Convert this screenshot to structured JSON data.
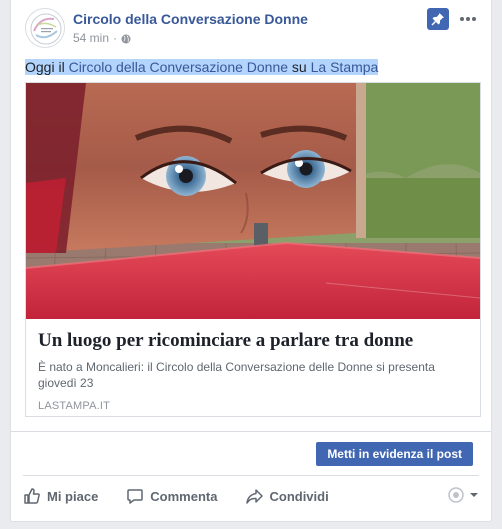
{
  "post": {
    "page_name": "Circolo della Conversazione Donne",
    "time": "54 min",
    "separator": "·",
    "text_prefix": "Oggi il ",
    "text_link1": "Circolo della Conversazione Donne",
    "text_middle": " su ",
    "text_link2": "La Stampa"
  },
  "share": {
    "title": "Un luogo per ricominciare a parlare tra donne",
    "description": "È nato a Moncalieri: il Circolo della Conversazione delle Donne si presenta giovedì 23",
    "domain": "LASTAMPA.IT"
  },
  "boost_label": "Metti in evidenza il post",
  "actions": {
    "like": "Mi piace",
    "comment": "Commenta",
    "share": "Condividi"
  },
  "colors": {
    "link": "#385898",
    "button": "#4267b2",
    "selection": "#b3d4fc"
  },
  "icons": [
    "globe-icon",
    "pin-icon",
    "more-icon",
    "like-icon",
    "comment-icon",
    "share-icon",
    "viewer-icon",
    "chevron-down-icon"
  ]
}
